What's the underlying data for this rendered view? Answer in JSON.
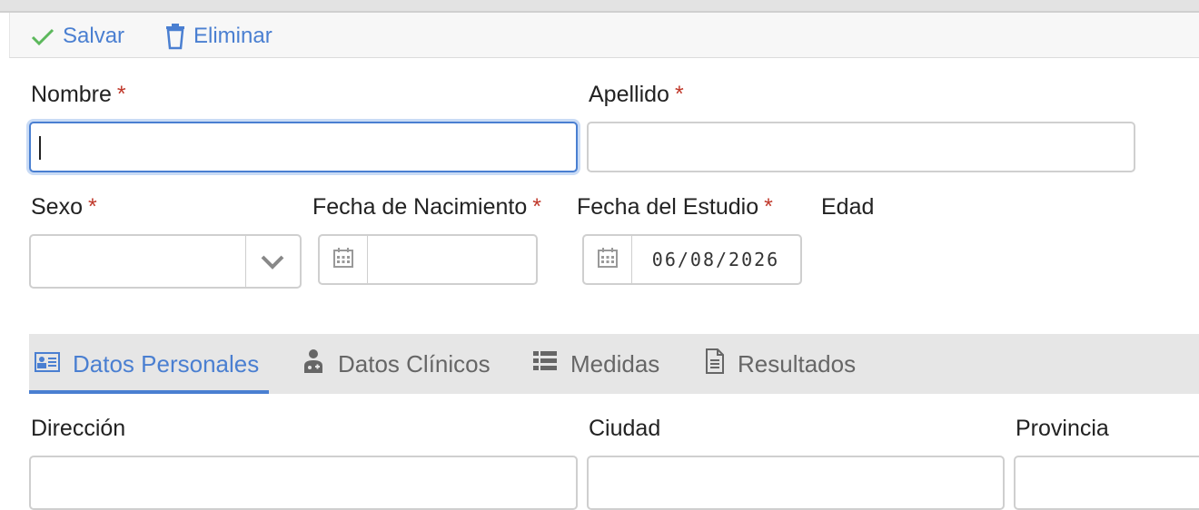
{
  "toolbar": {
    "save_label": "Salvar",
    "delete_label": "Eliminar"
  },
  "form": {
    "nombre_label": "Nombre",
    "apellido_label": "Apellido",
    "sexo_label": "Sexo",
    "fecha_nacimiento_label": "Fecha de Nacimiento",
    "fecha_estudio_label": "Fecha del Estudio",
    "fecha_estudio_value": "06/08/2026",
    "edad_label": "Edad",
    "required_marker": "*"
  },
  "tabs": [
    {
      "label": "Datos Personales",
      "icon": "id-card-icon",
      "active": true
    },
    {
      "label": "Datos Clínicos",
      "icon": "doctor-icon",
      "active": false
    },
    {
      "label": "Medidas",
      "icon": "list-icon",
      "active": false
    },
    {
      "label": "Resultados",
      "icon": "document-icon",
      "active": false
    }
  ],
  "personal": {
    "direccion_label": "Dirección",
    "ciudad_label": "Ciudad",
    "provincia_label": "Provincia"
  },
  "colors": {
    "accent": "#4a7fd1",
    "required": "#c0392b",
    "save_check": "#5cb85c"
  }
}
